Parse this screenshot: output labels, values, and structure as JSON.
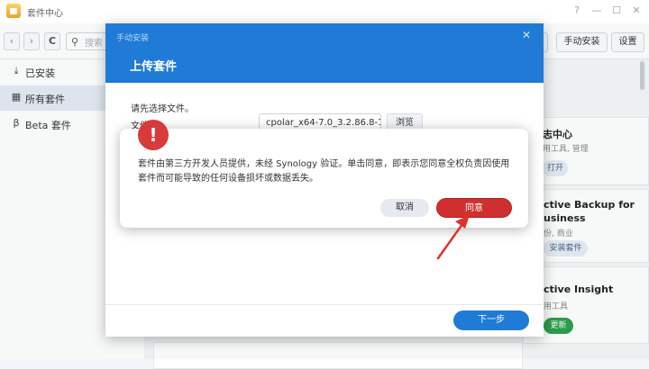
{
  "window": {
    "title": "套件中心",
    "controls": {
      "help": "?",
      "minimize": "—",
      "maximize": "☐",
      "close": "✕"
    }
  },
  "toolbar": {
    "back": "‹",
    "forward": "›",
    "refresh": "C",
    "search_placeholder": "搜索",
    "manual_install": "手动安装",
    "settings": "设置"
  },
  "sidebar": {
    "items": [
      {
        "label": "已安装",
        "icon": "download-icon",
        "active": false
      },
      {
        "label": "所有套件",
        "icon": "grid-icon",
        "active": true
      },
      {
        "label": "Beta 套件",
        "icon": "beta-icon",
        "active": false
      }
    ]
  },
  "packages": [
    {
      "title": "志中心",
      "subtitle": "用工具, 管理",
      "button": "打开"
    },
    {
      "title": "ctive Backup for",
      "title2": "usiness",
      "subtitle": "份, 商业",
      "button": "安装套件"
    },
    {
      "title": "ctive Insight",
      "subtitle": "用工具",
      "button": "更新"
    }
  ],
  "install_dialog": {
    "subtitle": "手动安装",
    "close": "✕",
    "heading": "上传套件",
    "prompt": "请先选择文件。",
    "file_label": "文件",
    "file_value": "cpolar_x64-7.0_3.2.86.8-1",
    "browse": "浏览",
    "next": "下一步"
  },
  "warning_dialog": {
    "badge": "!",
    "message": "套件由第三方开发人员提供，未经 Synology 验证。单击同意，即表示您同意全权负责因使用套件而可能导致的任何设备损坏或数据丢失。",
    "cancel": "取消",
    "agree": "同意"
  },
  "colors": {
    "accent_blue": "#1f7bd6",
    "danger_red": "#cf2f2f",
    "success_green": "#2aa04a"
  }
}
